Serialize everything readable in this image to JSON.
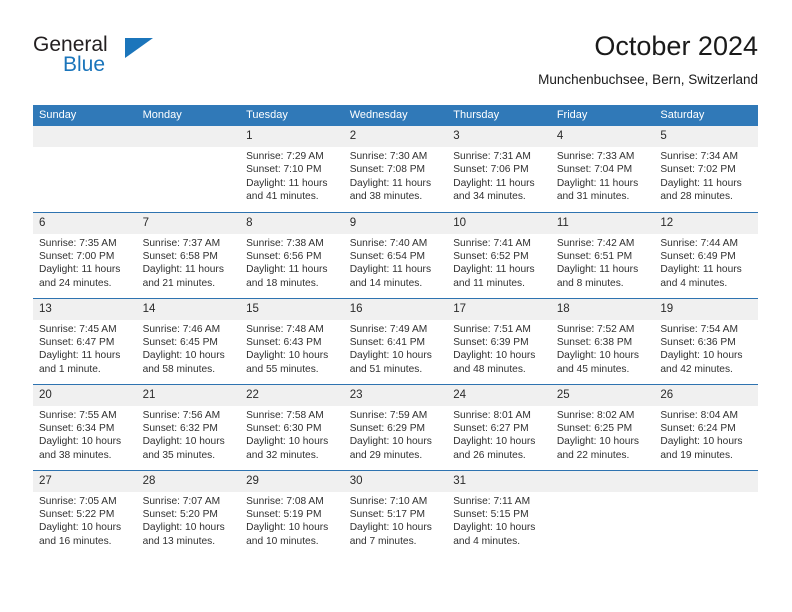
{
  "logo": {
    "primary_text": "General",
    "secondary_text": "Blue",
    "primary_color": "#231f20",
    "accent_color": "#1b75bb",
    "triangle_icon": "triangle-icon"
  },
  "header": {
    "title": "October 2024",
    "subtitle": "Munchenbuchsee, Bern, Switzerland"
  },
  "theme": {
    "header_bg": "#3079b8",
    "row_border": "#2e73b0",
    "daynum_bg": "#f0f0f0",
    "text": "#303030"
  },
  "weekday_headers": [
    "Sunday",
    "Monday",
    "Tuesday",
    "Wednesday",
    "Thursday",
    "Friday",
    "Saturday"
  ],
  "weeks": [
    [
      {
        "day": "",
        "sunrise": "",
        "sunset": "",
        "daylight_line1": "",
        "daylight_line2": ""
      },
      {
        "day": "",
        "sunrise": "",
        "sunset": "",
        "daylight_line1": "",
        "daylight_line2": ""
      },
      {
        "day": "1",
        "sunrise": "Sunrise: 7:29 AM",
        "sunset": "Sunset: 7:10 PM",
        "daylight_line1": "Daylight: 11 hours",
        "daylight_line2": "and 41 minutes."
      },
      {
        "day": "2",
        "sunrise": "Sunrise: 7:30 AM",
        "sunset": "Sunset: 7:08 PM",
        "daylight_line1": "Daylight: 11 hours",
        "daylight_line2": "and 38 minutes."
      },
      {
        "day": "3",
        "sunrise": "Sunrise: 7:31 AM",
        "sunset": "Sunset: 7:06 PM",
        "daylight_line1": "Daylight: 11 hours",
        "daylight_line2": "and 34 minutes."
      },
      {
        "day": "4",
        "sunrise": "Sunrise: 7:33 AM",
        "sunset": "Sunset: 7:04 PM",
        "daylight_line1": "Daylight: 11 hours",
        "daylight_line2": "and 31 minutes."
      },
      {
        "day": "5",
        "sunrise": "Sunrise: 7:34 AM",
        "sunset": "Sunset: 7:02 PM",
        "daylight_line1": "Daylight: 11 hours",
        "daylight_line2": "and 28 minutes."
      }
    ],
    [
      {
        "day": "6",
        "sunrise": "Sunrise: 7:35 AM",
        "sunset": "Sunset: 7:00 PM",
        "daylight_line1": "Daylight: 11 hours",
        "daylight_line2": "and 24 minutes."
      },
      {
        "day": "7",
        "sunrise": "Sunrise: 7:37 AM",
        "sunset": "Sunset: 6:58 PM",
        "daylight_line1": "Daylight: 11 hours",
        "daylight_line2": "and 21 minutes."
      },
      {
        "day": "8",
        "sunrise": "Sunrise: 7:38 AM",
        "sunset": "Sunset: 6:56 PM",
        "daylight_line1": "Daylight: 11 hours",
        "daylight_line2": "and 18 minutes."
      },
      {
        "day": "9",
        "sunrise": "Sunrise: 7:40 AM",
        "sunset": "Sunset: 6:54 PM",
        "daylight_line1": "Daylight: 11 hours",
        "daylight_line2": "and 14 minutes."
      },
      {
        "day": "10",
        "sunrise": "Sunrise: 7:41 AM",
        "sunset": "Sunset: 6:52 PM",
        "daylight_line1": "Daylight: 11 hours",
        "daylight_line2": "and 11 minutes."
      },
      {
        "day": "11",
        "sunrise": "Sunrise: 7:42 AM",
        "sunset": "Sunset: 6:51 PM",
        "daylight_line1": "Daylight: 11 hours",
        "daylight_line2": "and 8 minutes."
      },
      {
        "day": "12",
        "sunrise": "Sunrise: 7:44 AM",
        "sunset": "Sunset: 6:49 PM",
        "daylight_line1": "Daylight: 11 hours",
        "daylight_line2": "and 4 minutes."
      }
    ],
    [
      {
        "day": "13",
        "sunrise": "Sunrise: 7:45 AM",
        "sunset": "Sunset: 6:47 PM",
        "daylight_line1": "Daylight: 11 hours",
        "daylight_line2": "and 1 minute."
      },
      {
        "day": "14",
        "sunrise": "Sunrise: 7:46 AM",
        "sunset": "Sunset: 6:45 PM",
        "daylight_line1": "Daylight: 10 hours",
        "daylight_line2": "and 58 minutes."
      },
      {
        "day": "15",
        "sunrise": "Sunrise: 7:48 AM",
        "sunset": "Sunset: 6:43 PM",
        "daylight_line1": "Daylight: 10 hours",
        "daylight_line2": "and 55 minutes."
      },
      {
        "day": "16",
        "sunrise": "Sunrise: 7:49 AM",
        "sunset": "Sunset: 6:41 PM",
        "daylight_line1": "Daylight: 10 hours",
        "daylight_line2": "and 51 minutes."
      },
      {
        "day": "17",
        "sunrise": "Sunrise: 7:51 AM",
        "sunset": "Sunset: 6:39 PM",
        "daylight_line1": "Daylight: 10 hours",
        "daylight_line2": "and 48 minutes."
      },
      {
        "day": "18",
        "sunrise": "Sunrise: 7:52 AM",
        "sunset": "Sunset: 6:38 PM",
        "daylight_line1": "Daylight: 10 hours",
        "daylight_line2": "and 45 minutes."
      },
      {
        "day": "19",
        "sunrise": "Sunrise: 7:54 AM",
        "sunset": "Sunset: 6:36 PM",
        "daylight_line1": "Daylight: 10 hours",
        "daylight_line2": "and 42 minutes."
      }
    ],
    [
      {
        "day": "20",
        "sunrise": "Sunrise: 7:55 AM",
        "sunset": "Sunset: 6:34 PM",
        "daylight_line1": "Daylight: 10 hours",
        "daylight_line2": "and 38 minutes."
      },
      {
        "day": "21",
        "sunrise": "Sunrise: 7:56 AM",
        "sunset": "Sunset: 6:32 PM",
        "daylight_line1": "Daylight: 10 hours",
        "daylight_line2": "and 35 minutes."
      },
      {
        "day": "22",
        "sunrise": "Sunrise: 7:58 AM",
        "sunset": "Sunset: 6:30 PM",
        "daylight_line1": "Daylight: 10 hours",
        "daylight_line2": "and 32 minutes."
      },
      {
        "day": "23",
        "sunrise": "Sunrise: 7:59 AM",
        "sunset": "Sunset: 6:29 PM",
        "daylight_line1": "Daylight: 10 hours",
        "daylight_line2": "and 29 minutes."
      },
      {
        "day": "24",
        "sunrise": "Sunrise: 8:01 AM",
        "sunset": "Sunset: 6:27 PM",
        "daylight_line1": "Daylight: 10 hours",
        "daylight_line2": "and 26 minutes."
      },
      {
        "day": "25",
        "sunrise": "Sunrise: 8:02 AM",
        "sunset": "Sunset: 6:25 PM",
        "daylight_line1": "Daylight: 10 hours",
        "daylight_line2": "and 22 minutes."
      },
      {
        "day": "26",
        "sunrise": "Sunrise: 8:04 AM",
        "sunset": "Sunset: 6:24 PM",
        "daylight_line1": "Daylight: 10 hours",
        "daylight_line2": "and 19 minutes."
      }
    ],
    [
      {
        "day": "27",
        "sunrise": "Sunrise: 7:05 AM",
        "sunset": "Sunset: 5:22 PM",
        "daylight_line1": "Daylight: 10 hours",
        "daylight_line2": "and 16 minutes."
      },
      {
        "day": "28",
        "sunrise": "Sunrise: 7:07 AM",
        "sunset": "Sunset: 5:20 PM",
        "daylight_line1": "Daylight: 10 hours",
        "daylight_line2": "and 13 minutes."
      },
      {
        "day": "29",
        "sunrise": "Sunrise: 7:08 AM",
        "sunset": "Sunset: 5:19 PM",
        "daylight_line1": "Daylight: 10 hours",
        "daylight_line2": "and 10 minutes."
      },
      {
        "day": "30",
        "sunrise": "Sunrise: 7:10 AM",
        "sunset": "Sunset: 5:17 PM",
        "daylight_line1": "Daylight: 10 hours",
        "daylight_line2": "and 7 minutes."
      },
      {
        "day": "31",
        "sunrise": "Sunrise: 7:11 AM",
        "sunset": "Sunset: 5:15 PM",
        "daylight_line1": "Daylight: 10 hours",
        "daylight_line2": "and 4 minutes."
      },
      {
        "day": "",
        "sunrise": "",
        "sunset": "",
        "daylight_line1": "",
        "daylight_line2": ""
      },
      {
        "day": "",
        "sunrise": "",
        "sunset": "",
        "daylight_line1": "",
        "daylight_line2": ""
      }
    ]
  ]
}
